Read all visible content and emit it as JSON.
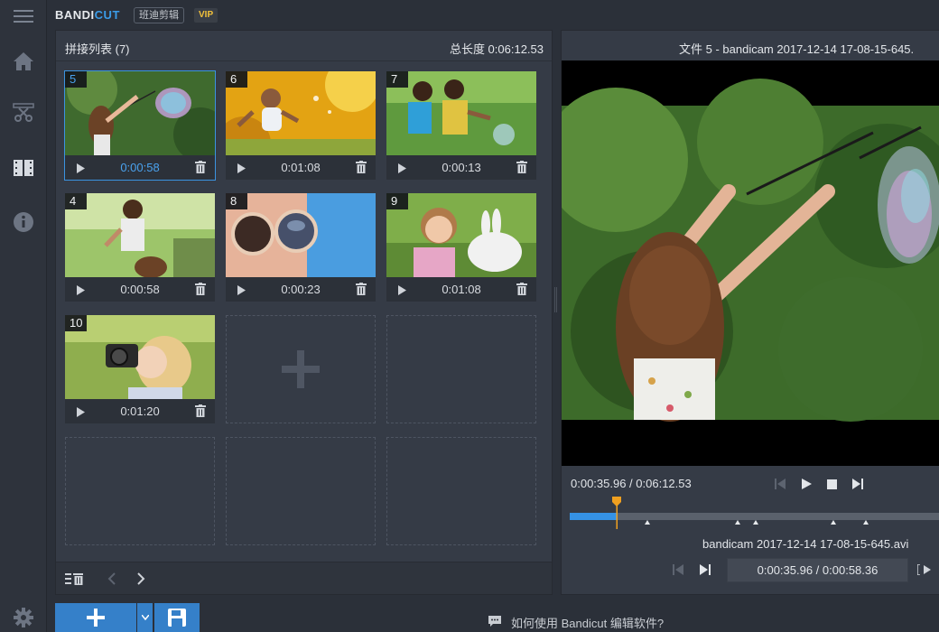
{
  "app": {
    "logo_main": "BANDI",
    "logo_accent": "CUT",
    "name_cn": "班迪剪辑",
    "vip_badge": "VIP"
  },
  "sidebar": {
    "items": [
      {
        "name": "menu",
        "icon": "hamburger-menu-icon"
      },
      {
        "name": "home",
        "icon": "home-icon"
      },
      {
        "name": "cutter",
        "icon": "scissors-film-icon"
      },
      {
        "name": "joiner",
        "icon": "film-strip-icon",
        "active": true
      },
      {
        "name": "info",
        "icon": "info-icon"
      },
      {
        "name": "settings",
        "icon": "gear-icon"
      }
    ]
  },
  "join_list": {
    "title": "拼接列表 (7)",
    "total_length": "总长度 0:06:12.53",
    "clips": [
      {
        "num": "5",
        "duration": "0:00:58",
        "selected": true
      },
      {
        "num": "6",
        "duration": "0:01:08"
      },
      {
        "num": "7",
        "duration": "0:00:13"
      },
      {
        "num": "4",
        "duration": "0:00:58"
      },
      {
        "num": "8",
        "duration": "0:00:23"
      },
      {
        "num": "9",
        "duration": "0:01:08"
      },
      {
        "num": "10",
        "duration": "0:01:20"
      }
    ]
  },
  "preview": {
    "title": "文件 5 - bandicam 2017-12-14 17-08-15-645.",
    "time": "0:00:35.96 / 0:06:12.53",
    "file_name": "bandicam 2017-12-14 17-08-15-645.avi",
    "segment_time": "0:00:35.96 / 0:00:58.36",
    "playhead_fraction": 0.127
  },
  "bottom": {
    "help_text": "如何使用 Bandicut 编辑软件?"
  },
  "colors": {
    "accent": "#3592e5",
    "playhead": "#f0a020",
    "vip": "#f3c23b"
  }
}
